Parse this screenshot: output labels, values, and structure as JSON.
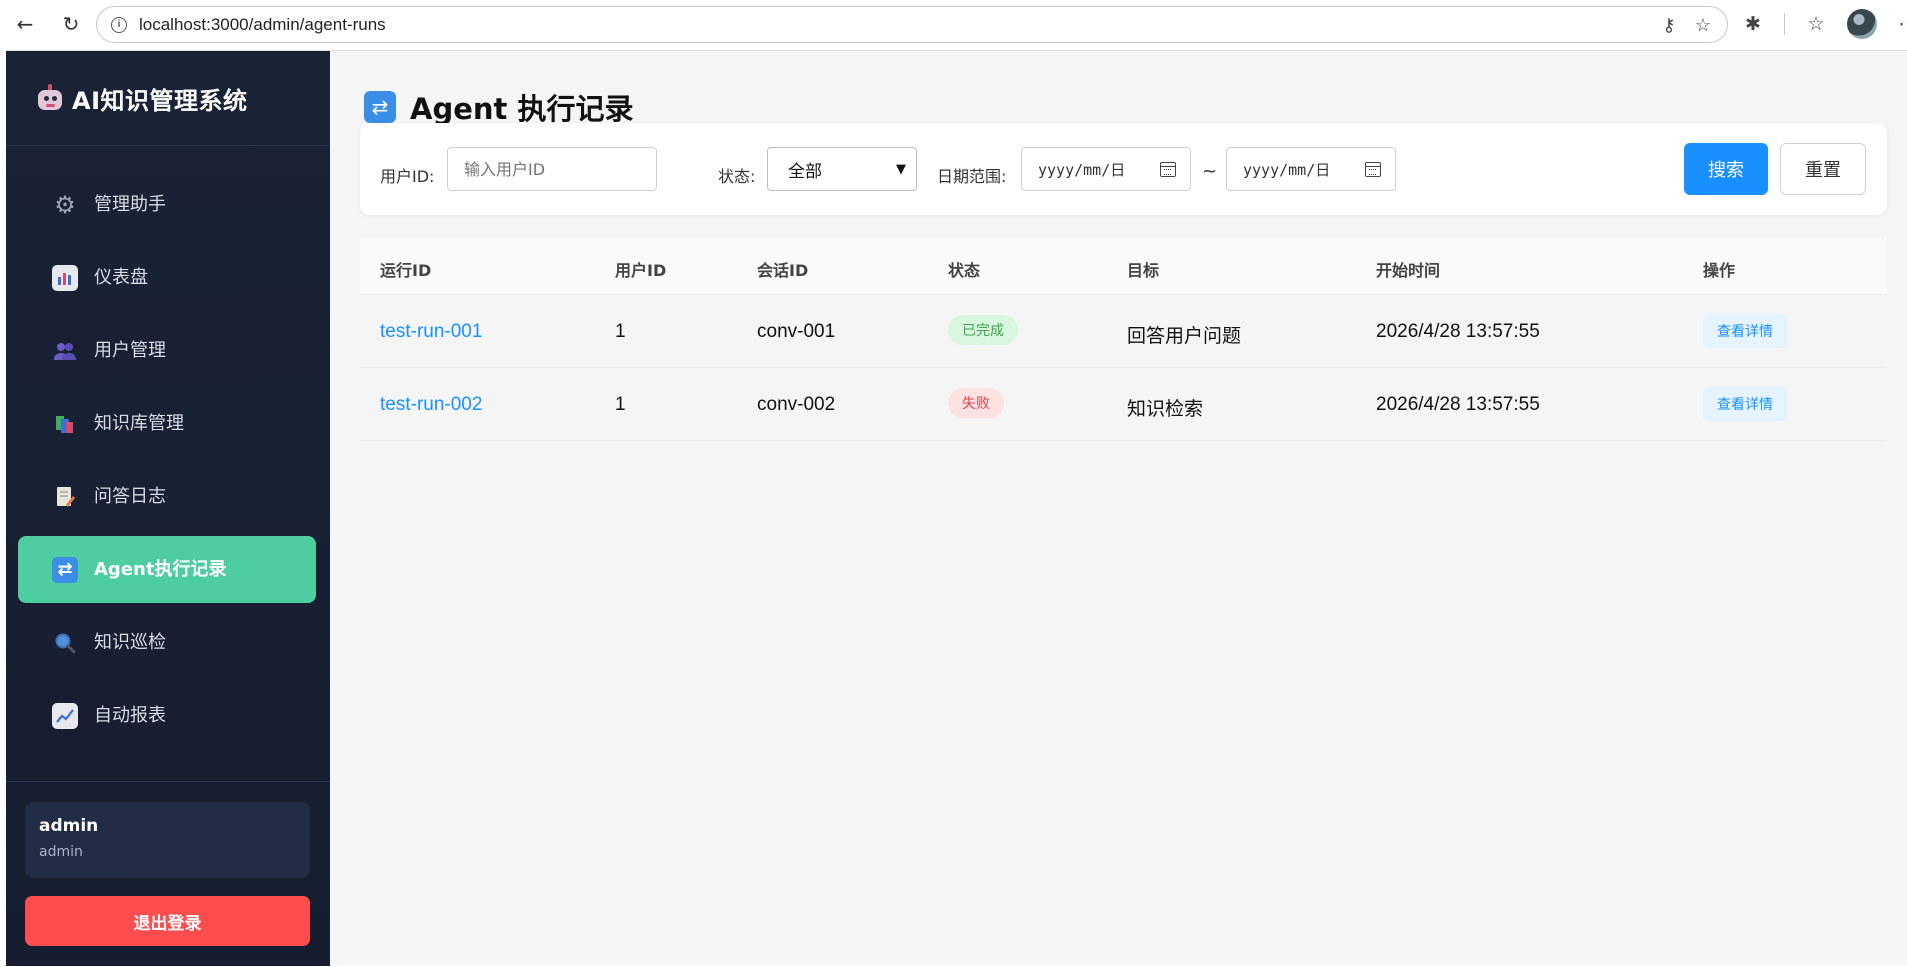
{
  "browser": {
    "url": "localhost:3000/admin/agent-runs"
  },
  "sidebar": {
    "brand": "AI知识管理系统",
    "items": [
      {
        "label": "管理助手",
        "icon": "gear-icon",
        "active": false
      },
      {
        "label": "仪表盘",
        "icon": "bar-chart-icon",
        "active": false
      },
      {
        "label": "用户管理",
        "icon": "users-icon",
        "active": false
      },
      {
        "label": "知识库管理",
        "icon": "books-icon",
        "active": false
      },
      {
        "label": "问答日志",
        "icon": "memo-icon",
        "active": false
      },
      {
        "label": "Agent执行记录",
        "icon": "refresh-icon",
        "active": true
      },
      {
        "label": "知识巡检",
        "icon": "magnifier-icon",
        "active": false
      },
      {
        "label": "自动报表",
        "icon": "trend-chart-icon",
        "active": false
      }
    ],
    "user": {
      "name": "admin",
      "role": "admin"
    },
    "logout_label": "退出登录"
  },
  "page": {
    "title": "Agent 执行记录"
  },
  "filters": {
    "user_id_label": "用户ID:",
    "user_id_placeholder": "输入用户ID",
    "status_label": "状态:",
    "status_value": "全部",
    "date_label": "日期范围:",
    "date_start_placeholder": "yyyy/mm/日",
    "date_separator": "~",
    "date_end_placeholder": "yyyy/mm/日",
    "search_label": "搜索",
    "reset_label": "重置"
  },
  "table": {
    "columns": [
      "运行ID",
      "用户ID",
      "会话ID",
      "状态",
      "目标",
      "开始时间",
      "操作"
    ],
    "rows": [
      {
        "run_id": "test-run-001",
        "user_id": "1",
        "session_id": "conv-001",
        "status": "已完成",
        "goal": "回答用户问题",
        "start_time": "2026/4/28 13:57:55",
        "action": "查看详情"
      },
      {
        "run_id": "test-run-002",
        "user_id": "1",
        "session_id": "conv-002",
        "status": "失败",
        "goal": "知识检索",
        "start_time": "2026/4/28 13:57:55",
        "action": "查看详情"
      }
    ]
  },
  "colors": {
    "accent": "#1890ff",
    "active_menu": "#4ecda0",
    "danger": "#ff4d4f",
    "sidebar_bg": "#1a2236"
  }
}
